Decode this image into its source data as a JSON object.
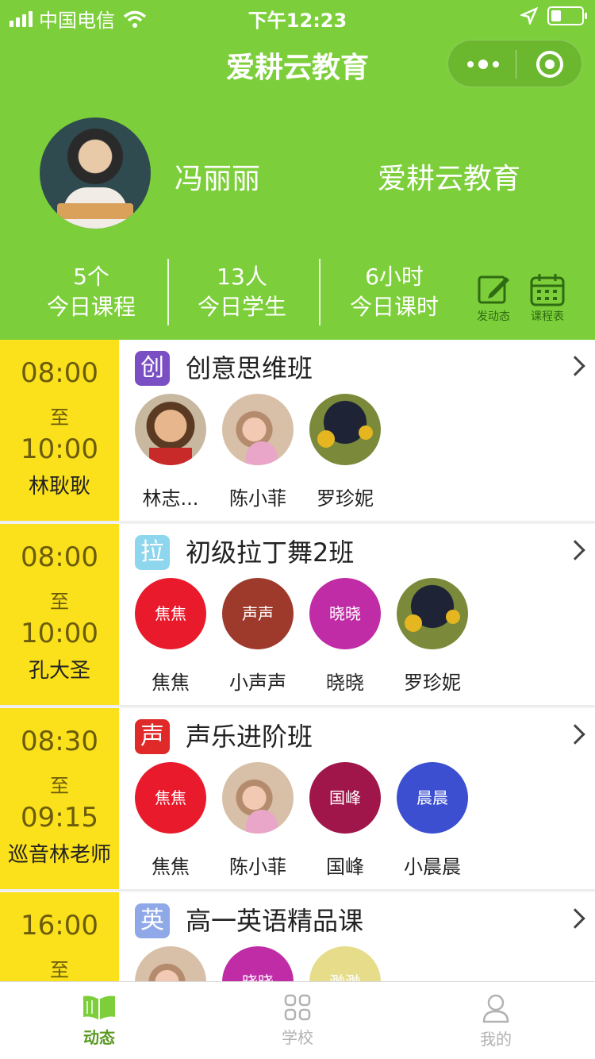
{
  "status_bar": {
    "carrier": "中国电信",
    "time": "下午12:23"
  },
  "nav": {
    "title": "爱耕云教育"
  },
  "profile": {
    "teacher_name": "冯丽丽",
    "school_name": "爱耕云教育"
  },
  "stats": [
    {
      "value": "5个",
      "label": "今日课程"
    },
    {
      "value": "13人",
      "label": "今日学生"
    },
    {
      "value": "6小时",
      "label": "今日课时"
    }
  ],
  "tools": {
    "post": "发动态",
    "schedule": "课程表"
  },
  "courses": [
    {
      "start": "08:00",
      "to": "至",
      "end": "10:00",
      "teacher": "林耿耿",
      "badge": "创",
      "badge_color": "#7b4fc4",
      "title": "创意思维班",
      "students": [
        {
          "name": "林志...",
          "avatar_text": "",
          "photo": "boy"
        },
        {
          "name": "陈小菲",
          "avatar_text": "",
          "photo": "girl"
        },
        {
          "name": "罗珍妮",
          "avatar_text": "",
          "photo": "flower"
        }
      ]
    },
    {
      "start": "08:00",
      "to": "至",
      "end": "10:00",
      "teacher": "孔大圣",
      "badge": "拉",
      "badge_color": "#8ed6ee",
      "title": "初级拉丁舞2班",
      "students": [
        {
          "name": "焦焦",
          "avatar_text": "焦焦",
          "color": "#e81a2c"
        },
        {
          "name": "小声声",
          "avatar_text": "声声",
          "color": "#9e3a2c"
        },
        {
          "name": "晓晓",
          "avatar_text": "晓晓",
          "color": "#c02ca6"
        },
        {
          "name": "罗珍妮",
          "avatar_text": "",
          "photo": "flower"
        }
      ]
    },
    {
      "start": "08:30",
      "to": "至",
      "end": "09:15",
      "teacher": "巡音林老师",
      "badge": "声",
      "badge_color": "#e02a2a",
      "title": "声乐进阶班",
      "students": [
        {
          "name": "焦焦",
          "avatar_text": "焦焦",
          "color": "#e81a2c"
        },
        {
          "name": "陈小菲",
          "avatar_text": "",
          "photo": "girl"
        },
        {
          "name": "国峰",
          "avatar_text": "国峰",
          "color": "#a0154a"
        },
        {
          "name": "小晨晨",
          "avatar_text": "晨晨",
          "color": "#3b4fd0"
        }
      ]
    },
    {
      "start": "16:00",
      "to": "至",
      "end": "",
      "teacher": "",
      "badge": "英",
      "badge_color": "#8fa8e8",
      "title": "高一英语精品课",
      "students": [
        {
          "name": "",
          "avatar_text": "",
          "photo": "girl"
        },
        {
          "name": "",
          "avatar_text": "晓晓",
          "color": "#c02ca6"
        },
        {
          "name": "",
          "avatar_text": "渺渺",
          "color": "#e6dc8a"
        }
      ]
    }
  ],
  "tabbar": [
    {
      "label": "动态",
      "icon": "book-open-icon",
      "active": true
    },
    {
      "label": "学校",
      "icon": "grid-icon",
      "active": false
    },
    {
      "label": "我的",
      "icon": "user-icon",
      "active": false
    }
  ]
}
